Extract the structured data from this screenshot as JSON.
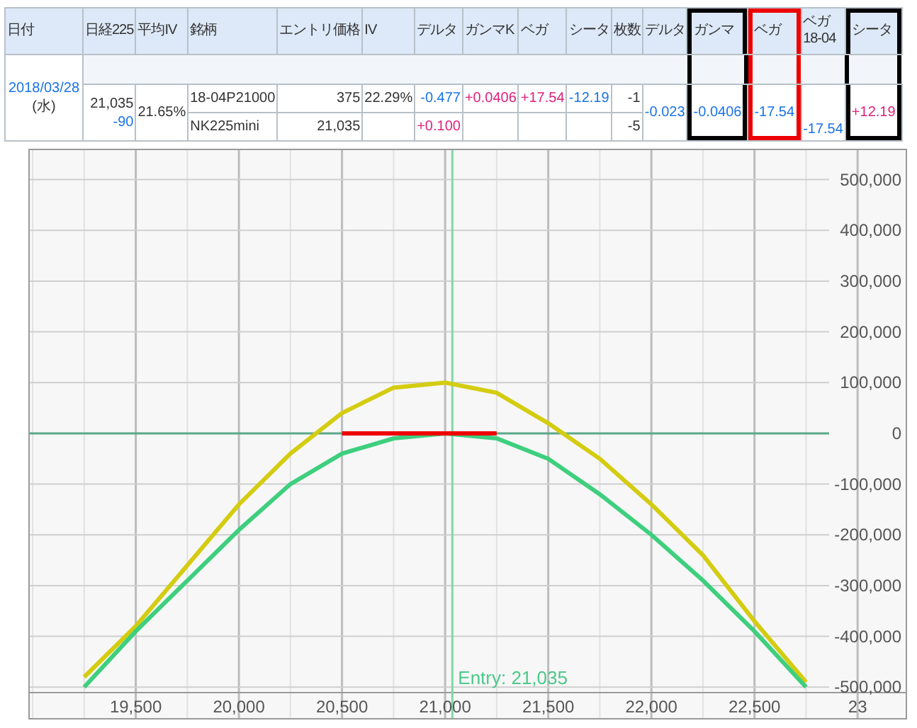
{
  "table": {
    "columns": [
      {
        "label": "日付"
      },
      {
        "label": "日経225"
      },
      {
        "label": "平均IV"
      },
      {
        "label": "銘柄"
      },
      {
        "label": "エントリ価格"
      },
      {
        "label": "IV"
      },
      {
        "label": "デルタ"
      },
      {
        "label": "ガンマK"
      },
      {
        "label": "ベガ"
      },
      {
        "label": "シータ"
      },
      {
        "label": "枚数"
      },
      {
        "label": "デルタ"
      },
      {
        "label": "ガンマ",
        "color": "#000000"
      },
      {
        "label": "ベガ",
        "color": "#ee0000"
      },
      {
        "label": "ベガ",
        "sublabel": "18-04"
      },
      {
        "label": "シータ",
        "color": "#000000"
      }
    ],
    "date": {
      "text": "2018/03/28",
      "weekday": "(水)"
    },
    "nikkei": {
      "price": "21,035",
      "change": {
        "text": "-90",
        "negative": true
      }
    },
    "avg_iv": "21.65%",
    "legs": [
      {
        "name": "18-04P21000",
        "entry_price": "375",
        "iv": "22.29%",
        "delta": {
          "text": "-0.477",
          "negative": true
        },
        "gamma_k": {
          "text": "+0.0406",
          "negative": false
        },
        "vega": {
          "text": "+17.54",
          "negative": false
        },
        "theta": {
          "text": "-12.19",
          "negative": true
        },
        "quantity": "-1"
      },
      {
        "name": "NK225mini",
        "entry_price": "21,035",
        "delta": {
          "text": "+0.100",
          "negative": false
        },
        "quantity": "-5"
      }
    ],
    "totals": [
      {
        "text": "-0.023",
        "negative": true
      },
      {
        "text": "-0.0406",
        "negative": true
      },
      {
        "text": "-17.54",
        "negative": true
      },
      {
        "text": "-17.54",
        "negative": true
      },
      {
        "text": "+12.19",
        "negative": false
      }
    ]
  },
  "chart": {
    "cut_tick_label": "23",
    "chart_data": {
      "type": "line",
      "grid": true,
      "x": [
        19250,
        19500,
        19750,
        20000,
        20250,
        20500,
        20750,
        21000,
        21250,
        21500,
        21750,
        22000,
        22250,
        22500,
        22750
      ],
      "series": [
        {
          "color": "#d4cc10",
          "values": [
            -480000,
            -380000,
            -260000,
            -140000,
            -40000,
            40000,
            90000,
            100000,
            80000,
            20000,
            -50000,
            -140000,
            -240000,
            -370000,
            -490000
          ]
        },
        {
          "color": "#3ecf7e",
          "values": [
            -500000,
            -390000,
            -290000,
            -190000,
            -100000,
            -40000,
            -10000,
            0,
            -10000,
            -50000,
            -120000,
            -200000,
            -290000,
            -390000,
            -500000
          ]
        },
        {
          "color": "#ee0000",
          "values": [
            null,
            null,
            null,
            null,
            null,
            0,
            0,
            0,
            0,
            null,
            null,
            null,
            null,
            null,
            null
          ]
        }
      ],
      "xlim": [
        18986,
        23233
      ],
      "ylim": [
        -561000,
        558000
      ],
      "xticks": [
        {
          "value": 19500,
          "label": "19,500"
        },
        {
          "value": 20000,
          "label": "20,000"
        },
        {
          "value": 20500,
          "label": "20,500"
        },
        {
          "value": 21000,
          "label": "21,000"
        },
        {
          "value": 21500,
          "label": "21,500"
        },
        {
          "value": 22000,
          "label": "22,000"
        },
        {
          "value": 22500,
          "label": "22,500"
        }
      ],
      "yticks": [
        {
          "value": 500000,
          "label": "500,000"
        },
        {
          "value": 400000,
          "label": "400,000"
        },
        {
          "value": 300000,
          "label": "300,000"
        },
        {
          "value": 200000,
          "label": "200,000"
        },
        {
          "value": 100000,
          "label": "100,000"
        },
        {
          "value": 0,
          "label": "0"
        },
        {
          "value": -100000,
          "label": "-100,000"
        },
        {
          "value": -200000,
          "label": "-200,000"
        },
        {
          "value": -300000,
          "label": "-300,000"
        },
        {
          "value": -400000,
          "label": "-400,000"
        },
        {
          "value": -500000,
          "label": "-500,000"
        }
      ],
      "ref_lines": [
        {
          "axis": "x",
          "value": 21035
        },
        {
          "axis": "y",
          "value": 0
        }
      ],
      "annotations": [
        "Entry: 21,035"
      ]
    }
  }
}
